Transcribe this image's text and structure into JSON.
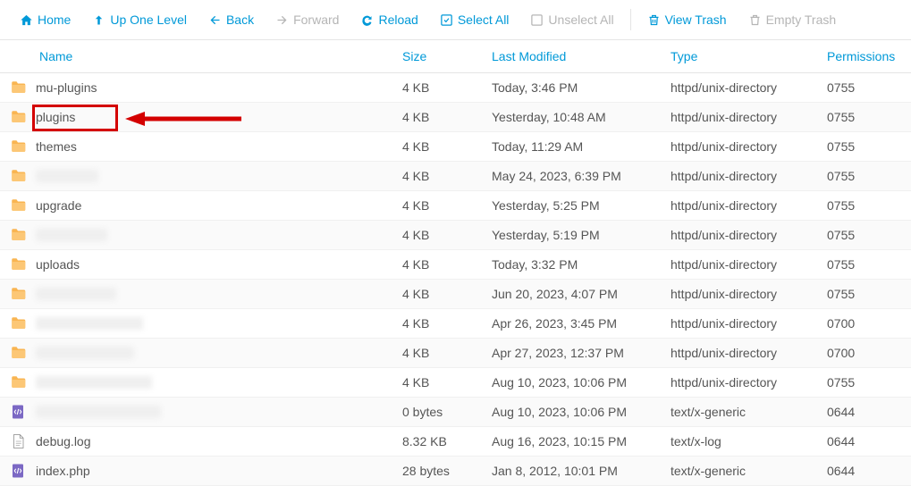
{
  "toolbar": {
    "home": "Home",
    "up": "Up One Level",
    "back": "Back",
    "forward": "Forward",
    "reload": "Reload",
    "selectAll": "Select All",
    "unselectAll": "Unselect All",
    "viewTrash": "View Trash",
    "emptyTrash": "Empty Trash"
  },
  "headers": {
    "name": "Name",
    "size": "Size",
    "modified": "Last Modified",
    "type": "Type",
    "permissions": "Permissions"
  },
  "rows": [
    {
      "icon": "folder",
      "name": "mu-plugins",
      "redacted": false,
      "size": "4 KB",
      "modified": "Today, 3:46 PM",
      "type": "httpd/unix-directory",
      "perm": "0755",
      "highlight": false
    },
    {
      "icon": "folder",
      "name": "plugins",
      "redacted": false,
      "size": "4 KB",
      "modified": "Yesterday, 10:48 AM",
      "type": "httpd/unix-directory",
      "perm": "0755",
      "highlight": true
    },
    {
      "icon": "folder",
      "name": "themes",
      "redacted": false,
      "size": "4 KB",
      "modified": "Today, 11:29 AM",
      "type": "httpd/unix-directory",
      "perm": "0755",
      "highlight": false
    },
    {
      "icon": "folder",
      "name": "",
      "redacted": true,
      "redactWidth": 70,
      "size": "4 KB",
      "modified": "May 24, 2023, 6:39 PM",
      "type": "httpd/unix-directory",
      "perm": "0755",
      "highlight": false
    },
    {
      "icon": "folder",
      "name": "upgrade",
      "redacted": false,
      "size": "4 KB",
      "modified": "Yesterday, 5:25 PM",
      "type": "httpd/unix-directory",
      "perm": "0755",
      "highlight": false
    },
    {
      "icon": "folder",
      "name": "",
      "redacted": true,
      "redactWidth": 80,
      "size": "4 KB",
      "modified": "Yesterday, 5:19 PM",
      "type": "httpd/unix-directory",
      "perm": "0755",
      "highlight": false
    },
    {
      "icon": "folder",
      "name": "uploads",
      "redacted": false,
      "size": "4 KB",
      "modified": "Today, 3:32 PM",
      "type": "httpd/unix-directory",
      "perm": "0755",
      "highlight": false
    },
    {
      "icon": "folder",
      "name": "",
      "redacted": true,
      "redactWidth": 90,
      "size": "4 KB",
      "modified": "Jun 20, 2023, 4:07 PM",
      "type": "httpd/unix-directory",
      "perm": "0755",
      "highlight": false
    },
    {
      "icon": "folder",
      "name": "",
      "redacted": true,
      "redactWidth": 120,
      "size": "4 KB",
      "modified": "Apr 26, 2023, 3:45 PM",
      "type": "httpd/unix-directory",
      "perm": "0700",
      "highlight": false
    },
    {
      "icon": "folder",
      "name": "",
      "redacted": true,
      "redactWidth": 110,
      "size": "4 KB",
      "modified": "Apr 27, 2023, 12:37 PM",
      "type": "httpd/unix-directory",
      "perm": "0700",
      "highlight": false
    },
    {
      "icon": "folder",
      "name": "",
      "redacted": true,
      "redactWidth": 130,
      "size": "4 KB",
      "modified": "Aug 10, 2023, 10:06 PM",
      "type": "httpd/unix-directory",
      "perm": "0755",
      "highlight": false
    },
    {
      "icon": "script",
      "name": "",
      "redacted": true,
      "redactWidth": 140,
      "size": "0 bytes",
      "modified": "Aug 10, 2023, 10:06 PM",
      "type": "text/x-generic",
      "perm": "0644",
      "highlight": false
    },
    {
      "icon": "file",
      "name": "debug.log",
      "redacted": false,
      "size": "8.32 KB",
      "modified": "Aug 16, 2023, 10:15 PM",
      "type": "text/x-log",
      "perm": "0644",
      "highlight": false
    },
    {
      "icon": "script",
      "name": "index.php",
      "redacted": false,
      "size": "28 bytes",
      "modified": "Jan 8, 2012, 10:01 PM",
      "type": "text/x-generic",
      "perm": "0644",
      "highlight": false
    }
  ]
}
